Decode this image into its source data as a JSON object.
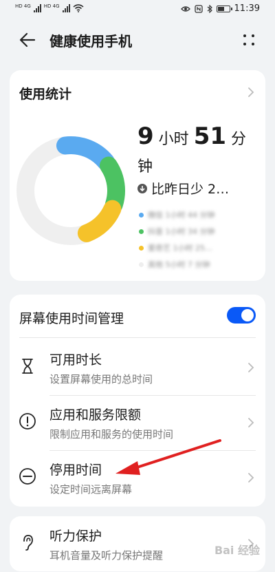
{
  "status_bar": {
    "network_labels": [
      "HD 4G",
      "HD 4G"
    ],
    "time": "11:39",
    "icons": [
      "eye-icon",
      "nfc-icon",
      "bluetooth-icon",
      "battery-icon"
    ]
  },
  "header": {
    "title": "健康使用手机",
    "back_icon": "back-arrow-icon",
    "more_icon": "more-dots-icon"
  },
  "usage_card": {
    "title": "使用统计",
    "total_time": {
      "hours": "9",
      "hours_unit": "小时",
      "minutes": "51",
      "minutes_unit": "分",
      "trailing": "钟"
    },
    "comparison": "比昨日少 2…",
    "legend_blurred": [
      {
        "text": "微信 1小时 44 分钟",
        "color": "#5aaaf0"
      },
      {
        "text": "抖音 1小时 34 分钟",
        "color": "#4cc262"
      },
      {
        "text": "爱奇艺 1小时 25…",
        "color": "#f5c22a"
      },
      {
        "text": "其他 5小时 7 分钟",
        "color": "#eeeeee"
      }
    ]
  },
  "chart_data": {
    "type": "pie",
    "style": "donut",
    "segments": [
      {
        "color": "#5aaaf0",
        "value": 104
      },
      {
        "color": "#4cc262",
        "value": 94
      },
      {
        "color": "#f5c22a",
        "value": 85
      },
      {
        "color": "#eeeeee",
        "value": 307
      }
    ]
  },
  "screen_time_card": {
    "toggle_label": "屏幕使用时间管理",
    "toggle_on": true,
    "items": [
      {
        "title": "可用时长",
        "subtitle": "设置屏幕使用的总时间",
        "icon": "hourglass-icon"
      },
      {
        "title": "应用和服务限额",
        "subtitle": "限制应用和服务的使用时间",
        "icon": "exclamation-circle-icon"
      },
      {
        "title": "停用时间",
        "subtitle": "设定时间远离屏幕",
        "icon": "minus-circle-icon"
      }
    ]
  },
  "hearing_card": {
    "title": "听力保护",
    "subtitle": "耳机音量及听力保护提醒",
    "icon": "ear-icon"
  },
  "annotation": {
    "arrow_color": "#e02020"
  },
  "watermark": "Bai 经验"
}
